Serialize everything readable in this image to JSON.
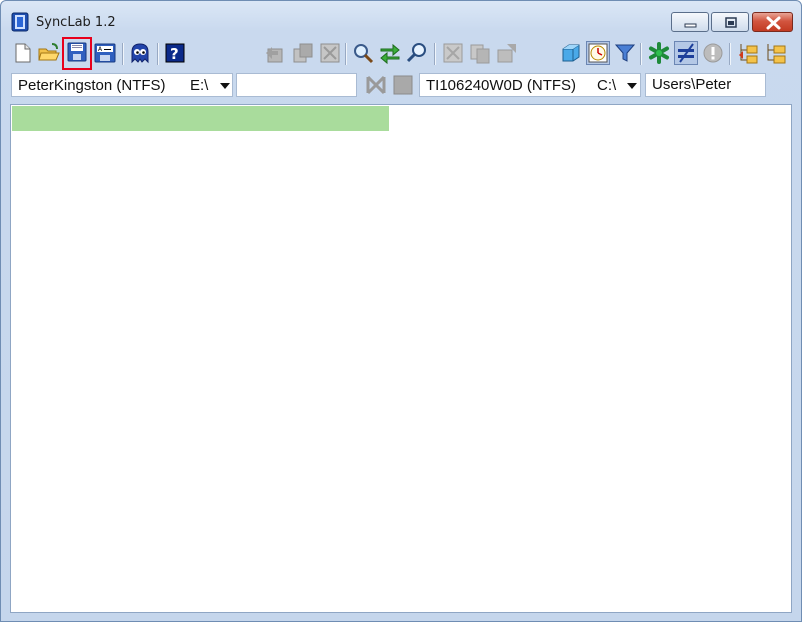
{
  "window": {
    "title": "SyncLab 1.2",
    "accent": "#c5d6ec",
    "close_color": "#c8422a"
  },
  "toolbar": {
    "buttons": [
      {
        "id": "new",
        "icon": "new-document-icon"
      },
      {
        "id": "open",
        "icon": "open-folder-icon"
      },
      {
        "id": "save",
        "icon": "floppy-save-icon",
        "selected": true
      },
      {
        "id": "save-as",
        "icon": "save-as-icon"
      },
      {
        "id": "ghost",
        "icon": "ghost-icon"
      },
      {
        "id": "help",
        "icon": "help-icon"
      },
      {
        "id": "copy-left",
        "icon": "copy-left-icon",
        "disabled": true
      },
      {
        "id": "copy-both",
        "icon": "copy-both-icon",
        "disabled": true
      },
      {
        "id": "delete",
        "icon": "delete-icon",
        "disabled": true
      },
      {
        "id": "scan",
        "icon": "magnifier-icon"
      },
      {
        "id": "sync",
        "icon": "sync-arrows-icon"
      },
      {
        "id": "find",
        "icon": "find-icon"
      },
      {
        "id": "mark-1",
        "icon": "mark-icon",
        "disabled": true
      },
      {
        "id": "mark-2",
        "icon": "copy-icon",
        "disabled": true
      },
      {
        "id": "mark-3",
        "icon": "move-icon",
        "disabled": true
      },
      {
        "id": "box-view",
        "icon": "box-icon"
      },
      {
        "id": "clock-view",
        "icon": "clock-icon",
        "active": true
      },
      {
        "id": "filter",
        "icon": "filter-icon"
      },
      {
        "id": "asterisk",
        "icon": "asterisk-icon"
      },
      {
        "id": "not-equal",
        "icon": "not-equal-icon",
        "active": true
      },
      {
        "id": "warning",
        "icon": "exclamation-icon",
        "disabled": true
      },
      {
        "id": "tree-left",
        "icon": "folder-tree-left-icon"
      },
      {
        "id": "tree-right",
        "icon": "folder-tree-right-icon"
      }
    ]
  },
  "left": {
    "volume": "PeterKingston (NTFS)",
    "drive": "E:\\",
    "path": ""
  },
  "right": {
    "volume": "TI106240W0D (NTFS)",
    "drive": "C:\\",
    "path": "Users\\Peter"
  },
  "status": {
    "progress": 0.485,
    "progress_color": "#a9dc9c"
  }
}
